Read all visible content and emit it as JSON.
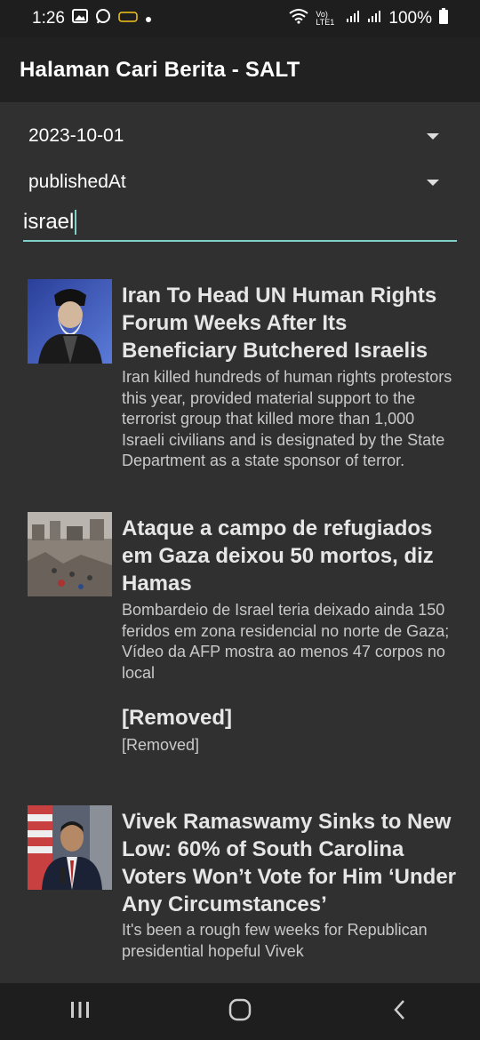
{
  "status": {
    "time": "1:26",
    "battery": "100%",
    "network": "Vo) LTE1"
  },
  "appbar": {
    "title": "Halaman Cari Berita - SALT"
  },
  "filters": {
    "date_value": "2023-10-01",
    "sort_value": "publishedAt",
    "search_value": "israel"
  },
  "articles": [
    {
      "title": "Iran To Head UN Human Rights Forum Weeks After Its Beneficiary Butchered Israelis",
      "description": "Iran killed hundreds of human rights protestors this year, provided material support to the terrorist group that killed more than 1,000 Israeli civilians and is designated by the State Department as a state sponsor of terror."
    },
    {
      "title": "Ataque a campo de refugiados em Gaza deixou 50 mortos, diz Hamas",
      "description": "Bombardeio de Israel teria deixado ainda 150 feridos em zona residencial no norte de Gaza; Vídeo da AFP mostra ao menos 47 corpos no local"
    },
    {
      "title": "[Removed]",
      "description": "[Removed]"
    },
    {
      "title": "Vivek Ramaswamy Sinks to New Low: 60% of South Carolina Voters Won’t Vote for Him ‘Under Any Circumstances’",
      "description": "It's been a rough few weeks for Republican presidential hopeful Vivek"
    }
  ],
  "colors": {
    "background": "#303030",
    "appbar": "#212121",
    "accent": "#7fd0c9"
  },
  "icons": {
    "status_left": [
      "gallery-icon",
      "whatsapp-icon",
      "app-notification-icon",
      "dot-icon"
    ],
    "status_right": [
      "wifi-icon",
      "signal-icon",
      "signal-icon",
      "battery-icon"
    ],
    "nav": [
      "recents-icon",
      "home-icon",
      "back-icon"
    ]
  }
}
